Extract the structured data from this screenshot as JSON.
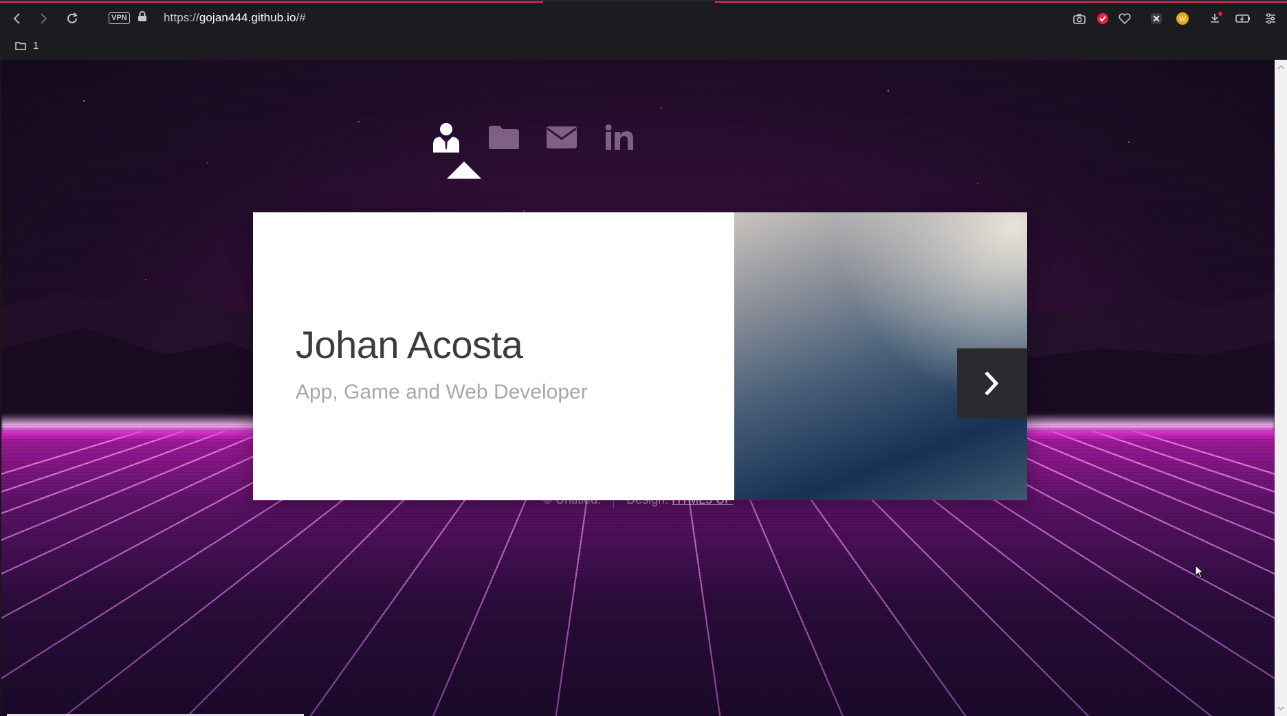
{
  "browser": {
    "vpn_label": "VPN",
    "url_prefix": "https://",
    "url_host": "gojan444.github.io",
    "url_suffix": "/#",
    "bookmark_folder_label": "1",
    "colors": {
      "accent": "#d9304f",
      "toolbar": "#1c1b20"
    }
  },
  "site_nav": {
    "items": [
      {
        "icon": "user-icon",
        "active": true
      },
      {
        "icon": "folder-icon",
        "active": false
      },
      {
        "icon": "envelope-icon",
        "active": false
      },
      {
        "icon": "linkedin-icon",
        "active": false
      }
    ]
  },
  "panel": {
    "name": "Johan Acosta",
    "tagline": "App, Game and Web Developer",
    "next_icon": "chevron-right-icon"
  },
  "footer": {
    "copyright": "© Untitled.",
    "design_label": "Design:",
    "design_link": "HTML5 UP"
  }
}
